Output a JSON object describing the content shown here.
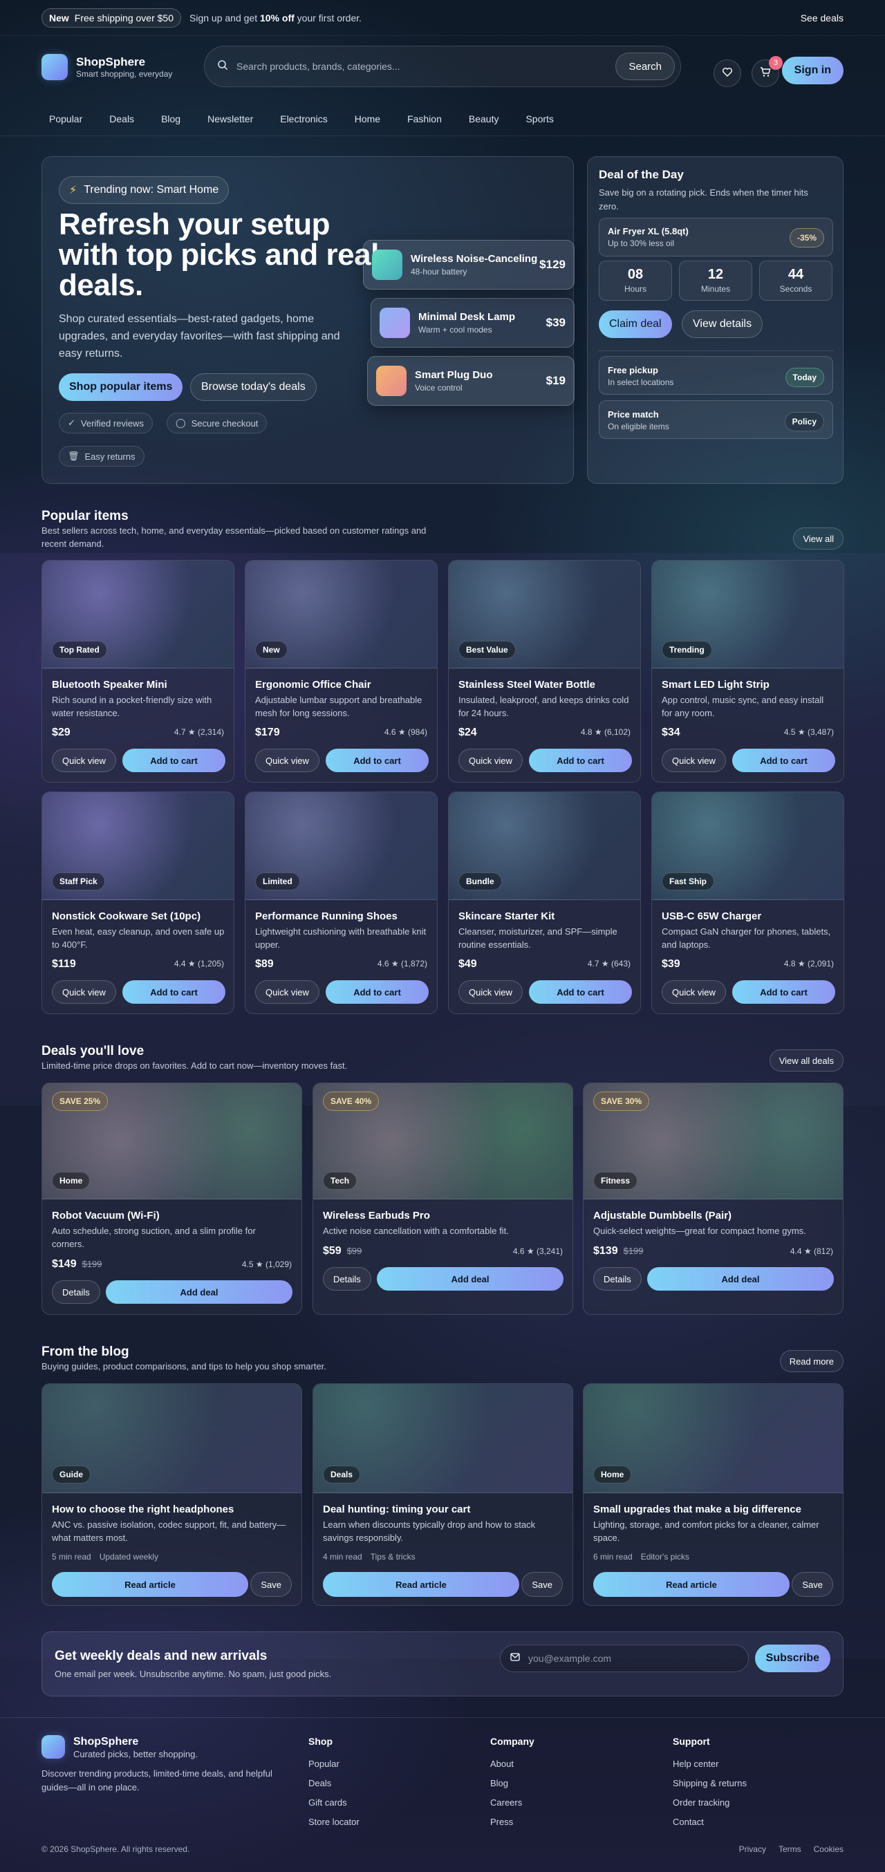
{
  "topbar": {
    "new_badge": "New",
    "shipping": "Free shipping over $50",
    "signup_pre": "Sign up and get ",
    "signup_bold": "10% off",
    "signup_post": " your first order.",
    "see_deals": "See deals"
  },
  "brand": {
    "name": "ShopSphere",
    "tagline": "Smart shopping, everyday"
  },
  "search": {
    "placeholder": "Search products, brands, categories...",
    "button": "Search"
  },
  "header": {
    "cart_count": "3",
    "sign_in": "Sign in"
  },
  "nav": [
    "Popular",
    "Deals",
    "Blog",
    "Newsletter",
    "Electronics",
    "Home",
    "Fashion",
    "Beauty",
    "Sports"
  ],
  "hero": {
    "trend": "Trending now: Smart Home",
    "title": "Refresh your setup with top picks and real deals.",
    "lead": "Shop curated essentials—best-rated gadgets, home upgrades, and everyday favorites—with fast shipping and easy returns.",
    "primary": "Shop popular items",
    "secondary": "Browse today's deals",
    "chips": [
      "Verified reviews",
      "Secure checkout",
      "Easy returns"
    ],
    "floats": [
      {
        "name": "Wireless Noise-Canceling",
        "sub": "48-hour battery",
        "price": "$129"
      },
      {
        "name": "Minimal Desk Lamp",
        "sub": "Warm + cool modes",
        "price": "$39"
      },
      {
        "name": "Smart Plug Duo",
        "sub": "Voice control",
        "price": "$19"
      }
    ]
  },
  "deal_of_day": {
    "title": "Deal of the Day",
    "desc": "Save big on a rotating pick. Ends when the timer hits zero.",
    "product": "Air Fryer XL (5.8qt)",
    "product_sub": "Up to 30% less oil",
    "discount": "-35%",
    "timer": [
      {
        "value": "08",
        "label": "Hours"
      },
      {
        "value": "12",
        "label": "Minutes"
      },
      {
        "value": "44",
        "label": "Seconds"
      }
    ],
    "claim": "Claim deal",
    "details": "View details",
    "perks": [
      {
        "title": "Free pickup",
        "sub": "In select locations",
        "tag": "Today"
      },
      {
        "title": "Price match",
        "sub": "On eligible items",
        "tag": "Policy"
      }
    ]
  },
  "popular": {
    "title": "Popular items",
    "subtitle": "Best sellers across tech, home, and everyday essentials—picked based on customer ratings and recent demand.",
    "view_all": "View all",
    "quick_view": "Quick view",
    "add_to_cart": "Add to cart",
    "items": [
      {
        "label": "Top Rated",
        "name": "Bluetooth Speaker Mini",
        "desc": "Rich sound in a pocket-friendly size with water resistance.",
        "price": "$29",
        "rating": "4.7 ★ (2,314)"
      },
      {
        "label": "New",
        "name": "Ergonomic Office Chair",
        "desc": "Adjustable lumbar support and breathable mesh for long sessions.",
        "price": "$179",
        "rating": "4.6 ★ (984)"
      },
      {
        "label": "Best Value",
        "name": "Stainless Steel Water Bottle",
        "desc": "Insulated, leakproof, and keeps drinks cold for 24 hours.",
        "price": "$24",
        "rating": "4.8 ★ (6,102)"
      },
      {
        "label": "Trending",
        "name": "Smart LED Light Strip",
        "desc": "App control, music sync, and easy install for any room.",
        "price": "$34",
        "rating": "4.5 ★ (3,487)"
      },
      {
        "label": "Staff Pick",
        "name": "Nonstick Cookware Set (10pc)",
        "desc": "Even heat, easy cleanup, and oven safe up to 400°F.",
        "price": "$119",
        "rating": "4.4 ★ (1,205)"
      },
      {
        "label": "Limited",
        "name": "Performance Running Shoes",
        "desc": "Lightweight cushioning with breathable knit upper.",
        "price": "$89",
        "rating": "4.6 ★ (1,872)"
      },
      {
        "label": "Bundle",
        "name": "Skincare Starter Kit",
        "desc": "Cleanser, moisturizer, and SPF—simple routine essentials.",
        "price": "$49",
        "rating": "4.7 ★ (643)"
      },
      {
        "label": "Fast Ship",
        "name": "USB-C 65W Charger",
        "desc": "Compact GaN charger for phones, tablets, and laptops.",
        "price": "$39",
        "rating": "4.8 ★ (2,091)"
      }
    ]
  },
  "deals": {
    "title": "Deals you'll love",
    "subtitle": "Limited-time price drops on favorites. Add to cart now—inventory moves fast.",
    "view_all": "View all deals",
    "details": "Details",
    "add_deal": "Add deal",
    "items": [
      {
        "save": "SAVE 25%",
        "label": "Home",
        "name": "Robot Vacuum (Wi-Fi)",
        "desc": "Auto schedule, strong suction, and a slim profile for corners.",
        "price": "$149",
        "was": "$199",
        "rating": "4.5 ★ (1,029)"
      },
      {
        "save": "SAVE 40%",
        "label": "Tech",
        "name": "Wireless Earbuds Pro",
        "desc": "Active noise cancellation with a comfortable fit.",
        "price": "$59",
        "was": "$99",
        "rating": "4.6 ★ (3,241)"
      },
      {
        "save": "SAVE 30%",
        "label": "Fitness",
        "name": "Adjustable Dumbbells (Pair)",
        "desc": "Quick-select weights—great for compact home gyms.",
        "price": "$139",
        "was": "$199",
        "rating": "4.4 ★ (812)"
      }
    ]
  },
  "blog": {
    "title": "From the blog",
    "subtitle": "Buying guides, product comparisons, and tips to help you shop smarter.",
    "read_more": "Read more",
    "read_article": "Read article",
    "save": "Save",
    "posts": [
      {
        "label": "Guide",
        "title": "How to choose the right headphones",
        "desc": "ANC vs. passive isolation, codec support, fit, and battery—what matters most.",
        "time": "5 min read",
        "meta": "Updated weekly"
      },
      {
        "label": "Deals",
        "title": "Deal hunting: timing your cart",
        "desc": "Learn when discounts typically drop and how to stack savings responsibly.",
        "time": "4 min read",
        "meta": "Tips & tricks"
      },
      {
        "label": "Home",
        "title": "Small upgrades that make a big difference",
        "desc": "Lighting, storage, and comfort picks for a cleaner, calmer space.",
        "time": "6 min read",
        "meta": "Editor's picks"
      }
    ]
  },
  "newsletter": {
    "title": "Get weekly deals and new arrivals",
    "subtitle": "One email per week. Unsubscribe anytime. No spam, just good picks.",
    "placeholder": "you@example.com",
    "button": "Subscribe"
  },
  "footer": {
    "name": "ShopSphere",
    "tagline": "Curated picks, better shopping.",
    "about": "Discover trending products, limited-time deals, and helpful guides—all in one place.",
    "cols": [
      {
        "title": "Shop",
        "links": [
          "Popular",
          "Deals",
          "Gift cards",
          "Store locator"
        ]
      },
      {
        "title": "Company",
        "links": [
          "About",
          "Blog",
          "Careers",
          "Press"
        ]
      },
      {
        "title": "Support",
        "links": [
          "Help center",
          "Shipping & returns",
          "Order tracking",
          "Contact"
        ]
      }
    ],
    "copyright": "© 2026 ShopSphere. All rights reserved.",
    "legal": [
      "Privacy",
      "Terms",
      "Cookies"
    ]
  }
}
